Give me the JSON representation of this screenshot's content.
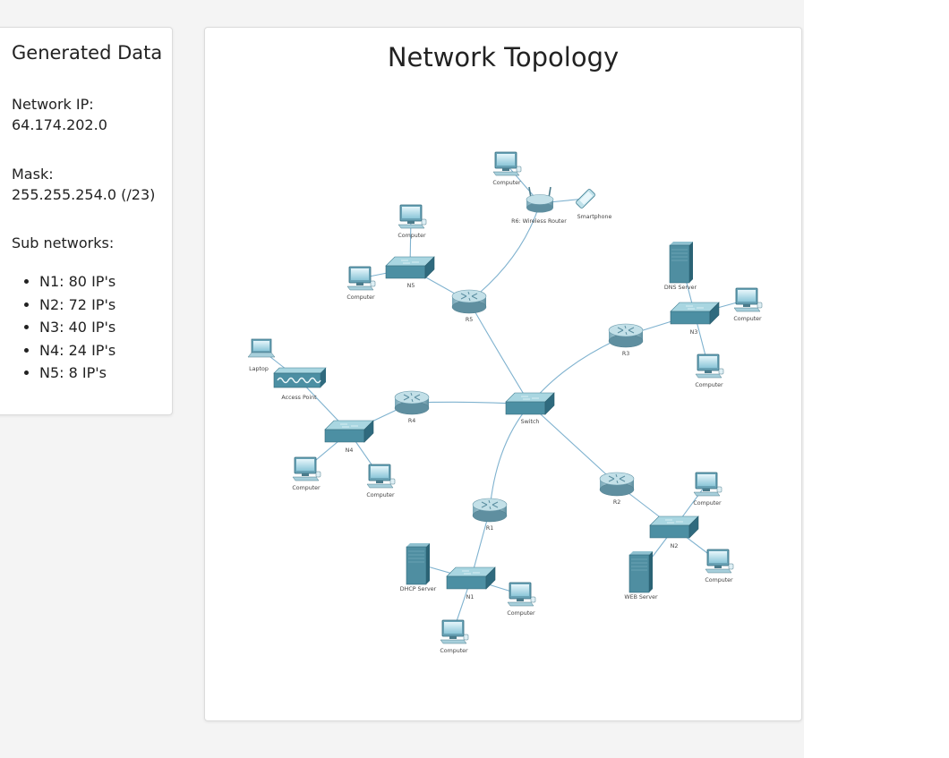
{
  "sidebar": {
    "title": "Generated Data",
    "network_ip_label": "Network IP:",
    "network_ip_value": "64.174.202.0",
    "mask_label": "Mask:",
    "mask_value": "255.255.254.0 (/23)",
    "subnets_label": "Sub networks:",
    "subnets": [
      "N1: 80 IP's",
      "N2: 72 IP's",
      "N3: 40 IP's",
      "N4: 24 IP's",
      "N5: 8 IP's"
    ]
  },
  "topology": {
    "title": "Network Topology",
    "nodes": [
      {
        "id": "sw",
        "type": "switch",
        "label": "Switch"
      },
      {
        "id": "r1",
        "type": "router",
        "label": "R1"
      },
      {
        "id": "r2",
        "type": "router",
        "label": "R2"
      },
      {
        "id": "r3",
        "type": "router",
        "label": "R3"
      },
      {
        "id": "r4",
        "type": "router",
        "label": "R4"
      },
      {
        "id": "r5",
        "type": "router",
        "label": "R5"
      },
      {
        "id": "r6",
        "type": "wrouter",
        "label": "R6: Wireless Router"
      },
      {
        "id": "phone",
        "type": "phone",
        "label": "Smartphone"
      },
      {
        "id": "c6",
        "type": "pc",
        "label": "Computer"
      },
      {
        "id": "n5",
        "type": "switch",
        "label": "N5"
      },
      {
        "id": "c5a",
        "type": "pc",
        "label": "Computer"
      },
      {
        "id": "c5b",
        "type": "pc",
        "label": "Computer"
      },
      {
        "id": "n3",
        "type": "switch",
        "label": "N3"
      },
      {
        "id": "dns",
        "type": "server",
        "label": "DNS Server"
      },
      {
        "id": "c3a",
        "type": "pc",
        "label": "Computer"
      },
      {
        "id": "c3b",
        "type": "pc",
        "label": "Computer"
      },
      {
        "id": "ap",
        "type": "ap",
        "label": "Access Point"
      },
      {
        "id": "laptop",
        "type": "laptop",
        "label": "Laptop"
      },
      {
        "id": "n4",
        "type": "switch",
        "label": "N4"
      },
      {
        "id": "c4a",
        "type": "pc",
        "label": "Computer"
      },
      {
        "id": "c4b",
        "type": "pc",
        "label": "Computer"
      },
      {
        "id": "n2",
        "type": "switch",
        "label": "N2"
      },
      {
        "id": "c2a",
        "type": "pc",
        "label": "Computer"
      },
      {
        "id": "c2b",
        "type": "pc",
        "label": "Computer"
      },
      {
        "id": "web",
        "type": "server",
        "label": "WEB Server"
      },
      {
        "id": "n1",
        "type": "switch",
        "label": "N1"
      },
      {
        "id": "dhcp",
        "type": "server",
        "label": "DHCP Server"
      },
      {
        "id": "c1a",
        "type": "pc",
        "label": "Computer"
      },
      {
        "id": "c1b",
        "type": "pc",
        "label": "Computer"
      }
    ],
    "links": [
      [
        "sw",
        "r4"
      ],
      [
        "sw",
        "r5"
      ],
      [
        "sw",
        "r3"
      ],
      [
        "sw",
        "r2"
      ],
      [
        "sw",
        "r1"
      ],
      [
        "r5",
        "n5"
      ],
      [
        "r5",
        "r6"
      ],
      [
        "n5",
        "c5a"
      ],
      [
        "n5",
        "c5b"
      ],
      [
        "r6",
        "c6"
      ],
      [
        "r6",
        "phone"
      ],
      [
        "r3",
        "n3"
      ],
      [
        "n3",
        "dns"
      ],
      [
        "n3",
        "c3a"
      ],
      [
        "n3",
        "c3b"
      ],
      [
        "r4",
        "n4"
      ],
      [
        "n4",
        "ap"
      ],
      [
        "n4",
        "c4a"
      ],
      [
        "n4",
        "c4b"
      ],
      [
        "ap",
        "laptop"
      ],
      [
        "r2",
        "n2"
      ],
      [
        "n2",
        "c2a"
      ],
      [
        "n2",
        "c2b"
      ],
      [
        "n2",
        "web"
      ],
      [
        "r1",
        "n1"
      ],
      [
        "n1",
        "dhcp"
      ],
      [
        "n1",
        "c1a"
      ],
      [
        "n1",
        "c1b"
      ]
    ]
  }
}
